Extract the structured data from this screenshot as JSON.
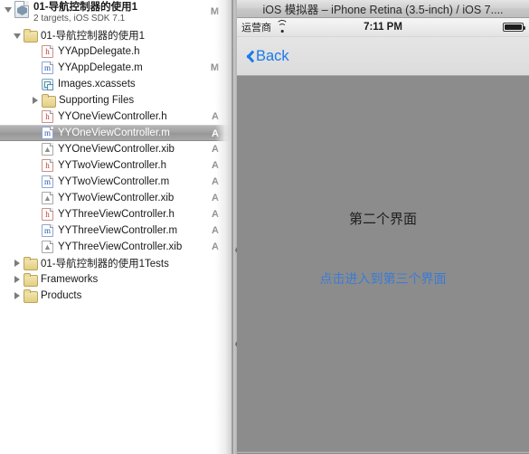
{
  "navigator": {
    "project": {
      "name": "01-导航控制器的使用1",
      "subtitle": "2 targets, iOS SDK 7.1",
      "status": "M",
      "icon": "xcode-project-icon"
    },
    "rows": [
      {
        "label": "01-导航控制器的使用1",
        "icon": "folder-icon",
        "status": "",
        "depth": 1,
        "twisty": "open",
        "selected": false
      },
      {
        "label": "YYAppDelegate.h",
        "icon": "header-file-icon",
        "status": "",
        "depth": 2,
        "twisty": "none",
        "selected": false
      },
      {
        "label": "YYAppDelegate.m",
        "icon": "source-file-icon",
        "status": "M",
        "depth": 2,
        "twisty": "none",
        "selected": false
      },
      {
        "label": "Images.xcassets",
        "icon": "asset-catalog-icon",
        "status": "",
        "depth": 2,
        "twisty": "none",
        "selected": false
      },
      {
        "label": "Supporting Files",
        "icon": "folder-icon",
        "status": "",
        "depth": 2,
        "twisty": "closed",
        "selected": false
      },
      {
        "label": "YYOneViewController.h",
        "icon": "header-file-icon",
        "status": "A",
        "depth": 2,
        "twisty": "none",
        "selected": false
      },
      {
        "label": "YYOneViewController.m",
        "icon": "source-file-icon",
        "status": "A",
        "depth": 2,
        "twisty": "none",
        "selected": true
      },
      {
        "label": "YYOneViewController.xib",
        "icon": "interface-file-icon",
        "status": "A",
        "depth": 2,
        "twisty": "none",
        "selected": false
      },
      {
        "label": "YYTwoViewController.h",
        "icon": "header-file-icon",
        "status": "A",
        "depth": 2,
        "twisty": "none",
        "selected": false
      },
      {
        "label": "YYTwoViewController.m",
        "icon": "source-file-icon",
        "status": "A",
        "depth": 2,
        "twisty": "none",
        "selected": false
      },
      {
        "label": "YYTwoViewController.xib",
        "icon": "interface-file-icon",
        "status": "A",
        "depth": 2,
        "twisty": "none",
        "selected": false
      },
      {
        "label": "YYThreeViewController.h",
        "icon": "header-file-icon",
        "status": "A",
        "depth": 2,
        "twisty": "none",
        "selected": false
      },
      {
        "label": "YYThreeViewController.m",
        "icon": "source-file-icon",
        "status": "A",
        "depth": 2,
        "twisty": "none",
        "selected": false
      },
      {
        "label": "YYThreeViewController.xib",
        "icon": "interface-file-icon",
        "status": "A",
        "depth": 2,
        "twisty": "none",
        "selected": false
      },
      {
        "label": "01-导航控制器的使用1Tests",
        "icon": "folder-icon",
        "status": "",
        "depth": 1,
        "twisty": "closed",
        "selected": false
      },
      {
        "label": "Frameworks",
        "icon": "folder-icon",
        "status": "",
        "depth": 1,
        "twisty": "closed",
        "selected": false
      },
      {
        "label": "Products",
        "icon": "folder-icon",
        "status": "",
        "depth": 1,
        "twisty": "closed",
        "selected": false
      }
    ]
  },
  "simulator": {
    "window_title": "iOS 模拟器 – iPhone Retina (3.5-inch) / iOS 7....",
    "statusbar": {
      "carrier": "运营商",
      "wifi_icon": "wifi-icon",
      "clock": "7:11 PM",
      "battery_icon": "battery-icon"
    },
    "navbar": {
      "back_label": "Back",
      "back_icon": "chevron-left-icon"
    },
    "screen": {
      "title": "第二个界面",
      "link": "点击进入到第三个界面"
    }
  },
  "colors": {
    "link_blue": "#3b7bd4",
    "back_blue": "#1a7aeb",
    "screen_bg": "#8c8c8c",
    "selection_gray": "#9d9d9d",
    "status_letter": "#8e8e8e"
  }
}
